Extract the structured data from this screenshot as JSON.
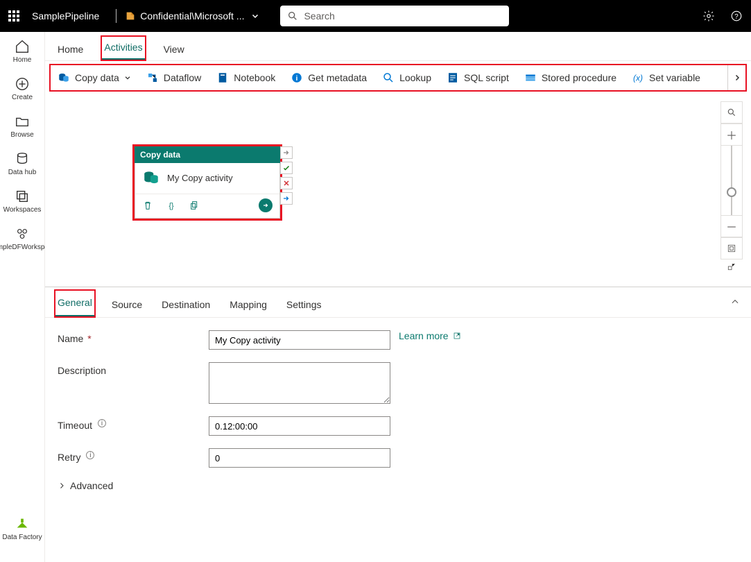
{
  "header": {
    "pipeline_name": "SamplePipeline",
    "workspace_label": "Confidential\\Microsoft ...",
    "search_placeholder": "Search"
  },
  "left_nav": {
    "items": [
      {
        "label": "Home"
      },
      {
        "label": "Create"
      },
      {
        "label": "Browse"
      },
      {
        "label": "Data hub"
      },
      {
        "label": "Workspaces"
      },
      {
        "label": "SampleDFWorkspace"
      }
    ],
    "bottom_label": "Data Factory"
  },
  "top_tabs": {
    "home": "Home",
    "activities": "Activities",
    "view": "View"
  },
  "ribbon": {
    "items": [
      {
        "label": "Copy data",
        "has_dropdown": true
      },
      {
        "label": "Dataflow"
      },
      {
        "label": "Notebook"
      },
      {
        "label": "Get metadata"
      },
      {
        "label": "Lookup"
      },
      {
        "label": "SQL script"
      },
      {
        "label": "Stored procedure"
      },
      {
        "label": "Set variable"
      }
    ]
  },
  "activity_card": {
    "title": "Copy data",
    "name": "My Copy activity"
  },
  "props_tabs": {
    "general": "General",
    "source": "Source",
    "destination": "Destination",
    "mapping": "Mapping",
    "settings": "Settings"
  },
  "form": {
    "name_label": "Name",
    "name_value": "My Copy activity",
    "learn_more": "Learn more",
    "desc_label": "Description",
    "desc_value": "",
    "timeout_label": "Timeout",
    "timeout_value": "0.12:00:00",
    "retry_label": "Retry",
    "retry_value": "0",
    "advanced": "Advanced"
  }
}
